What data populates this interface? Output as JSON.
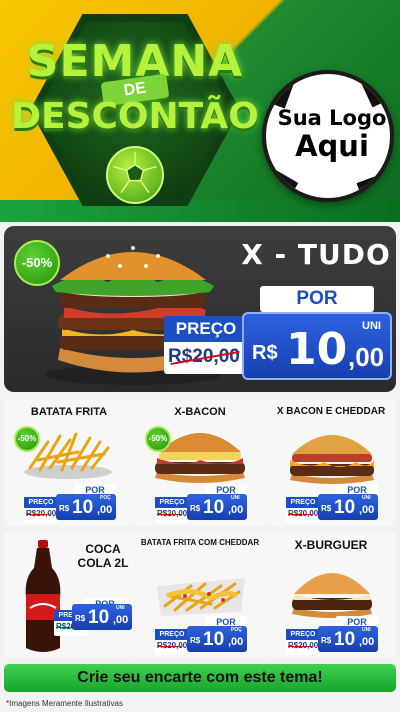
{
  "header": {
    "title_line1": "SEMANA",
    "title_connector": "DE",
    "title_line2": "DESCONTÃO",
    "logo_line1": "Sua Logo",
    "logo_line2": "Aqui"
  },
  "featured": {
    "discount_badge": "-50%",
    "name": "X - TUDO",
    "por_label": "POR",
    "preco_label": "PREÇO",
    "old_price": "R$20,00",
    "currency": "R$",
    "price_int": "10",
    "price_dec": ",00",
    "unit": "UNI"
  },
  "products": [
    {
      "name": "BATATA FRITA",
      "badge": "-50%",
      "por_label": "POR",
      "preco_label": "PREÇO",
      "old_price": "R$20,00",
      "currency": "R$",
      "price_int": "10",
      "price_dec": ",00",
      "unit": "POÇ"
    },
    {
      "name": "X-BACON",
      "badge": "-50%",
      "por_label": "POR",
      "preco_label": "PREÇO",
      "old_price": "R$20,00",
      "currency": "R$",
      "price_int": "10",
      "price_dec": ",00",
      "unit": "UNI"
    },
    {
      "name": "X BACON E CHEDDAR",
      "badge": "",
      "por_label": "POR",
      "preco_label": "PREÇO",
      "old_price": "R$20,00",
      "currency": "R$",
      "price_int": "10",
      "price_dec": ",00",
      "unit": "UNI"
    },
    {
      "name": "COCA COLA 2L",
      "badge": "",
      "por_label": "POR",
      "preco_label": "PREÇO",
      "old_price": "R$20,00",
      "currency": "R$",
      "price_int": "10",
      "price_dec": ",00",
      "unit": "UNI"
    },
    {
      "name": "BATATA FRITA COM CHEDDAR",
      "badge": "",
      "por_label": "POR",
      "preco_label": "PREÇO",
      "old_price": "R$20,00",
      "currency": "R$",
      "price_int": "10",
      "price_dec": ",00",
      "unit": "POÇ"
    },
    {
      "name": "X-BURGUER",
      "badge": "",
      "por_label": "POR",
      "preco_label": "PREÇO",
      "old_price": "R$20,00",
      "currency": "R$",
      "price_int": "10",
      "price_dec": ",00",
      "unit": "UNI"
    }
  ],
  "cta": {
    "label": "Crie seu encarte com este tema!"
  },
  "disclaimer": "*Imagens Meramente Ilustrativas",
  "colors": {
    "accent_blue": "#1d4fc4",
    "accent_green": "#2a9110",
    "header_yellow": "#f0b400",
    "header_green": "#0e6b22",
    "strike_red": "#d01010"
  },
  "icons": [
    "soccer-ball-icon",
    "burger-image",
    "fries-image",
    "cola-bottle-image",
    "cheddar-fries-image"
  ]
}
